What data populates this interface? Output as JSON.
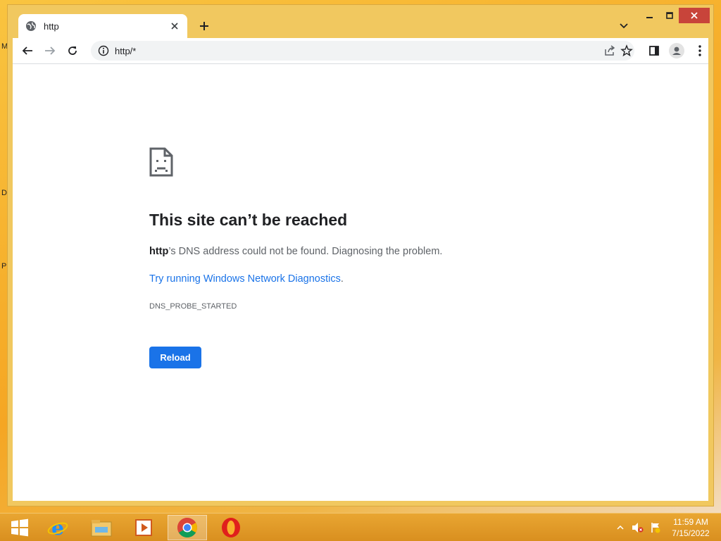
{
  "desktop": {
    "edge_letters": [
      "M",
      "D",
      "P"
    ]
  },
  "browser": {
    "tab": {
      "title": "http",
      "icon": "globe-icon"
    },
    "address_bar": {
      "url": "http/*",
      "icon": "info-icon"
    },
    "colors": {
      "accent": "#1a73e8",
      "window_frame": "#f1c85f",
      "close_button": "#c8443a"
    }
  },
  "error_page": {
    "title": "This site can’t be reached",
    "description_host": "http",
    "description_rest": "’s DNS address could not be found. Diagnosing the problem.",
    "link_text": "Try running Windows Network Diagnostics",
    "link_suffix": ".",
    "error_code": "DNS_PROBE_STARTED",
    "reload_label": "Reload"
  },
  "taskbar": {
    "items": [
      "start-icon",
      "internet-explorer-icon",
      "file-explorer-icon",
      "media-player-icon",
      "chrome-icon",
      "opera-icon"
    ],
    "active_item": "chrome-icon",
    "clock": {
      "time": "11:59 AM",
      "date": "7/15/2022"
    }
  }
}
